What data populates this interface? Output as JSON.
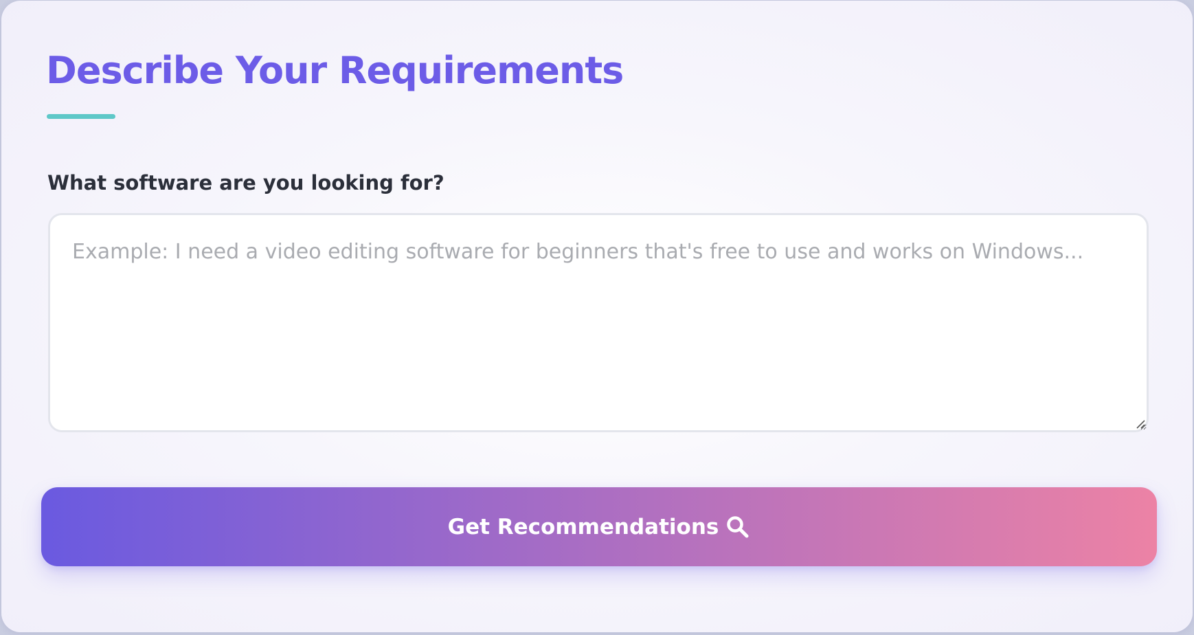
{
  "colors": {
    "title": "#6c5ce7",
    "accent_underline": "#5ec8c8",
    "button_gradient_start": "#6a5ae0",
    "button_gradient_end": "#ec82a5"
  },
  "form": {
    "title": "Describe Your Requirements",
    "question_label": "What software are you looking for?",
    "textarea": {
      "value": "",
      "placeholder": "Example: I need a video editing software for beginners that's free to use and works on Windows..."
    },
    "submit": {
      "label": "Get Recommendations",
      "icon": "search-icon"
    }
  }
}
